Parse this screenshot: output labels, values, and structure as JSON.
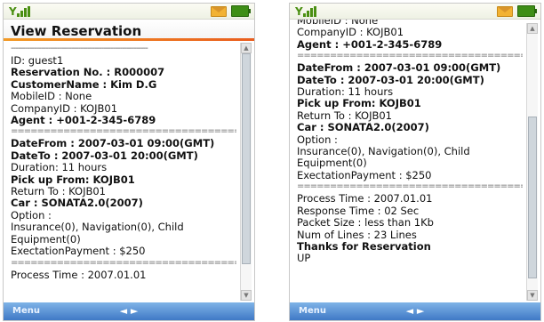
{
  "screens": {
    "left": {
      "title": "View Reservation",
      "lines": {
        "id": "ID: guest1",
        "reservation": "Reservation No. : R000007",
        "customer": "CustomerName : Kim D.G",
        "mobile": "MobileID : None",
        "company": "CompanyID : KOJB01",
        "agent": "Agent : +001-2-345-6789",
        "date_from": "DateFrom : 2007-03-01 09:00(GMT)",
        "date_to": "DateTo : 2007-03-01 20:00(GMT)",
        "duration": "Duration: 11 hours",
        "pickup": "Pick up From: KOJB01",
        "return": "Return To : KOJB01",
        "car": "Car : SONATA2.0(2007)",
        "option": "Option :",
        "insurance": "Insurance(0), Navigation(0), Child",
        "equipment": "Equipment(0)",
        "payment": "ExectationPayment : $250",
        "partial": "Process Time : 2007.01.01"
      }
    },
    "right": {
      "lines": {
        "mobile": "MobileID : None",
        "company": "CompanyID : KOJB01",
        "agent": "Agent : +001-2-345-6789",
        "date_from": "DateFrom : 2007-03-01 09:00(GMT)",
        "date_to": "DateTo : 2007-03-01 20:00(GMT)",
        "duration": "Duration: 11 hours",
        "pickup": "Pick up From: KOJB01",
        "return": "Return To : KOJB01",
        "car": "Car : SONATA2.0(2007)",
        "option": "Option :",
        "insurance": "Insurance(0), Navigation(0), Child",
        "equipment": "Equipment(0)",
        "payment": "ExectationPayment : $250",
        "process_time": "Process Time : 2007.01.01",
        "response_time": "Response Time : 02 Sec",
        "packet_size": "Packet Size : less than 1Kb",
        "num_lines": "Num of Lines : 23 Lines",
        "thanks": "Thanks for Reservation",
        "up": "UP"
      }
    }
  },
  "softkeys": {
    "left": "Menu",
    "nav": "◄ ►"
  },
  "icons": {
    "signal": "signal-strength-icon",
    "message": "message-envelope-icon",
    "battery": "battery-icon",
    "scroll_up": "scroll-up-arrow-icon",
    "scroll_down": "scroll-down-arrow-icon"
  },
  "colors": {
    "title_accent": "#f07a22",
    "softbar": "#4c86cf",
    "signal": "#4a8f12",
    "battery": "#3e8e16",
    "envelope": "#f2b233"
  }
}
